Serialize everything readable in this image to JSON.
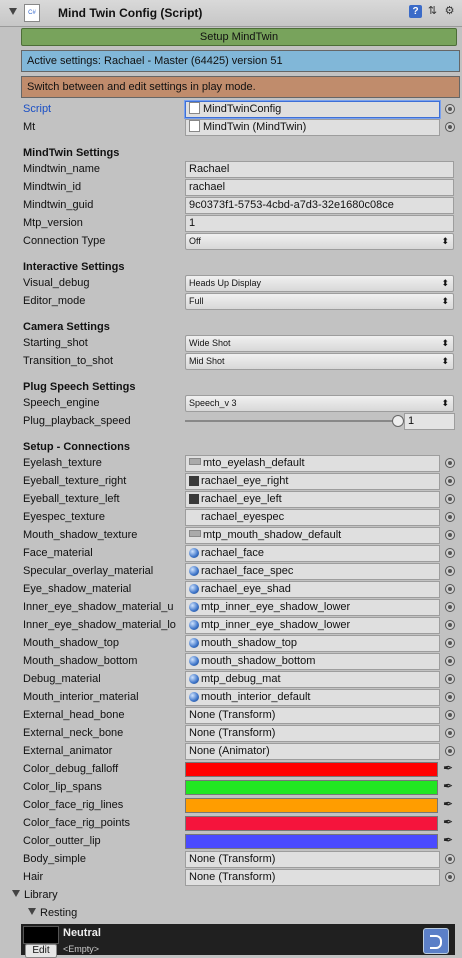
{
  "header": {
    "title": "Mind Twin Config (Script)",
    "script_icon_text": "C#"
  },
  "setup_button": "Setup MindTwin",
  "active_settings": "Active settings: Rachael - Master (64425) version 51",
  "play_mode_note": "Switch between and edit settings in play mode.",
  "fields_top": [
    {
      "label": "Script",
      "value": "MindTwinConfig"
    },
    {
      "label": "Mt",
      "value": "MindTwin (MindTwin)"
    }
  ],
  "sections": {
    "mindtwin": {
      "title": "MindTwin Settings",
      "rows": [
        {
          "label": "Mindtwin_name",
          "value": "Rachael"
        },
        {
          "label": "Mindtwin_id",
          "value": "rachael"
        },
        {
          "label": "Mindtwin_guid",
          "value": "9c0373f1-5753-4cbd-a7d3-32e1680c08ce"
        },
        {
          "label": "Mtp_version",
          "value": "1"
        },
        {
          "label": "Connection Type",
          "value": "Off"
        }
      ]
    },
    "interactive": {
      "title": "Interactive Settings",
      "rows": [
        {
          "label": "Visual_debug",
          "value": "Heads Up Display"
        },
        {
          "label": "Editor_mode",
          "value": "Full"
        }
      ]
    },
    "camera": {
      "title": "Camera Settings",
      "rows": [
        {
          "label": "Starting_shot",
          "value": "Wide Shot"
        },
        {
          "label": "Transition_to_shot",
          "value": "Mid Shot"
        }
      ]
    },
    "speech": {
      "title": "Plug Speech Settings",
      "rows": [
        {
          "label": "Speech_engine",
          "value": "Speech_v 3"
        },
        {
          "label": "Plug_playback_speed",
          "value": "1",
          "slider_fraction": 1.0
        }
      ]
    },
    "connections": {
      "title": "Setup - Connections",
      "rows": [
        {
          "label": "Eyelash_texture",
          "value": "mto_eyelash_default"
        },
        {
          "label": "Eyeball_texture_right",
          "value": "rachael_eye_right"
        },
        {
          "label": "Eyeball_texture_left",
          "value": "rachael_eye_left"
        },
        {
          "label": "Eyespec_texture",
          "value": "rachael_eyespec"
        },
        {
          "label": "Mouth_shadow_texture",
          "value": "mtp_mouth_shadow_default"
        },
        {
          "label": "Face_material",
          "value": "rachael_face"
        },
        {
          "label": "Specular_overlay_material",
          "value": "rachael_face_spec"
        },
        {
          "label": "Eye_shadow_material",
          "value": "rachael_eye_shad"
        },
        {
          "label": "Inner_eye_shadow_material_u",
          "value": "mtp_inner_eye_shadow_lower"
        },
        {
          "label": "Inner_eye_shadow_material_lo",
          "value": "mtp_inner_eye_shadow_lower"
        },
        {
          "label": "Mouth_shadow_top",
          "value": "mouth_shadow_top"
        },
        {
          "label": "Mouth_shadow_bottom",
          "value": "mouth_shadow_bottom"
        },
        {
          "label": "Debug_material",
          "value": "mtp_debug_mat"
        },
        {
          "label": "Mouth_interior_material",
          "value": "mouth_interior_default"
        },
        {
          "label": "External_head_bone",
          "value": "None (Transform)"
        },
        {
          "label": "External_neck_bone",
          "value": "None (Transform)"
        },
        {
          "label": "External_animator",
          "value": "None (Animator)"
        }
      ],
      "colors": [
        {
          "label": "Color_debug_falloff",
          "color": "#ff0000"
        },
        {
          "label": "Color_lip_spans",
          "color": "#22e622"
        },
        {
          "label": "Color_face_rig_lines",
          "color": "#ff9d00"
        },
        {
          "label": "Color_face_rig_points",
          "color": "#f5143c"
        },
        {
          "label": "Color_outter_lip",
          "color": "#4a4aff"
        }
      ],
      "tail": [
        {
          "label": "Body_simple",
          "value": "None (Transform)"
        },
        {
          "label": "Hair",
          "value": "None (Transform)"
        }
      ]
    }
  },
  "library": {
    "label": "Library",
    "resting": "Resting"
  },
  "bottom": {
    "title": "Neutral",
    "edit": "Edit",
    "sub": "<Empty>"
  }
}
